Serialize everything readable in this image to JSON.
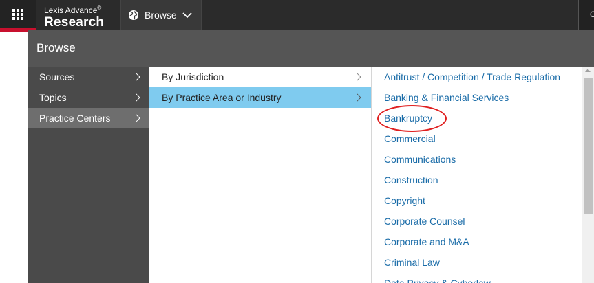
{
  "topbar": {
    "brand_top": "Lexis Advance",
    "brand_reg": "®",
    "brand_main": "Research",
    "browse_label": "Browse",
    "right_edge_text": "C",
    "icons": {
      "apps": "apps-grid-icon",
      "globe": "globe-icon",
      "browse_chevron": "chevron-down-icon"
    }
  },
  "panel": {
    "title": "Browse"
  },
  "menu": {
    "col1": [
      {
        "label": "Sources"
      },
      {
        "label": "Topics"
      },
      {
        "label": "Practice Centers",
        "active": true
      }
    ],
    "col2": [
      {
        "label": "By Jurisdiction"
      },
      {
        "label": "By Practice Area or Industry",
        "active": true
      }
    ],
    "col3": [
      {
        "label": "Antitrust / Competition / Trade Regulation"
      },
      {
        "label": "Banking & Financial Services"
      },
      {
        "label": "Bankruptcy",
        "highlighted": true
      },
      {
        "label": "Commercial"
      },
      {
        "label": "Communications"
      },
      {
        "label": "Construction"
      },
      {
        "label": "Copyright"
      },
      {
        "label": "Corporate Counsel"
      },
      {
        "label": "Corporate and M&A"
      },
      {
        "label": "Criminal Law"
      },
      {
        "label": "Data Privacy & Cyberlaw"
      }
    ]
  },
  "colors": {
    "active_highlight": "#7fcbef",
    "link": "#1a6ca8",
    "annotation": "#e02020",
    "brand_red": "#c8102e"
  }
}
